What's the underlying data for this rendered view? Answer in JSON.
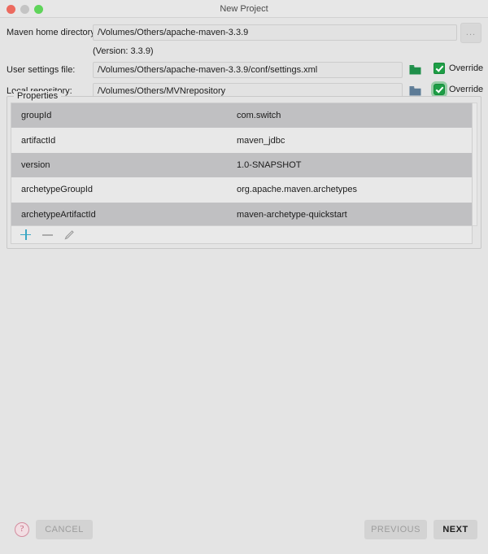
{
  "window": {
    "title": "New Project",
    "controls": {
      "close": "close-button",
      "minimize": "minimize-button",
      "zoom": "zoom-button"
    }
  },
  "form": {
    "maven_home": {
      "label": "Maven home directory:",
      "value": "/Volumes/Others/apache-maven-3.3.9",
      "browse_label": "...",
      "dropdown_icon": "chevron-down-icon"
    },
    "version_note": "(Version: 3.3.9)",
    "user_settings": {
      "label": "User settings file:",
      "value": "/Volumes/Others/apache-maven-3.3.9/conf/settings.xml",
      "folder_icon": "folder-icon",
      "folder_color": "#1f8f4a",
      "override_label": "Override",
      "override_checked": true,
      "focused": false
    },
    "local_repository": {
      "label": "Local repository:",
      "value": "/Volumes/Others/MVNrepository",
      "folder_icon": "folder-icon",
      "folder_color": "#5d7b96",
      "override_label": "Override",
      "override_checked": true,
      "focused": true
    }
  },
  "properties": {
    "legend": "Properties",
    "rows": [
      {
        "key": "groupId",
        "value": "com.switch"
      },
      {
        "key": "artifactId",
        "value": "maven_jdbc"
      },
      {
        "key": "version",
        "value": "1.0-SNAPSHOT"
      },
      {
        "key": "archetypeGroupId",
        "value": "org.apache.maven.archetypes"
      },
      {
        "key": "archetypeArtifactId",
        "value": "maven-archetype-quickstart"
      }
    ],
    "toolbar": {
      "add": {
        "icon": "plus-icon",
        "enabled": true,
        "color": "#3aa7c4"
      },
      "remove": {
        "icon": "minus-icon",
        "enabled": false,
        "color": "#ababab"
      },
      "edit": {
        "icon": "pencil-icon",
        "enabled": false,
        "color": "#9a9a9a"
      }
    }
  },
  "footer": {
    "help_label": "?",
    "cancel_label": "CANCEL",
    "cancel_enabled": false,
    "previous_label": "PREVIOUS",
    "previous_enabled": false,
    "next_label": "NEXT",
    "next_enabled": true
  },
  "colors": {
    "background": "#e4e4e4",
    "row_odd": "#c0c0c2",
    "row_even": "#e8e8e8",
    "accent_green": "#1e9e46",
    "accent_cyan": "#3aa7c4"
  }
}
